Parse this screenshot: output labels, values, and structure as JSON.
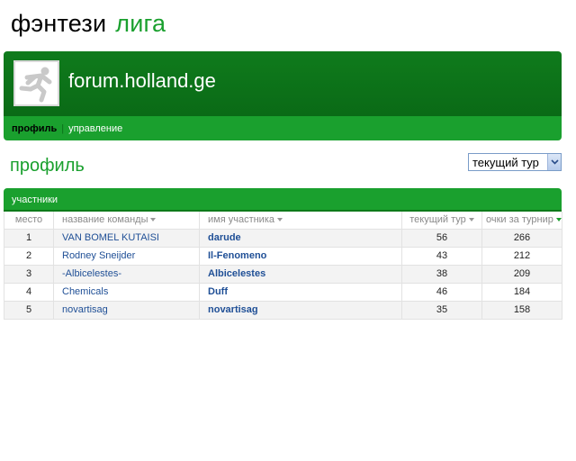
{
  "site": {
    "title_word1": "фэнтези",
    "title_word2": "лига"
  },
  "league": {
    "logo_icon": "runner-icon",
    "name": "forum.holland.ge",
    "tabs": [
      {
        "label": "профиль",
        "active": true
      },
      {
        "label": "управление",
        "active": false
      }
    ]
  },
  "section": {
    "title": "профиль"
  },
  "period_select": {
    "value": "текущий тур"
  },
  "members": {
    "title": "участники",
    "columns": [
      "место",
      "название команды",
      "имя участника",
      "текущий тур",
      "очки за турнир"
    ],
    "rows": [
      {
        "rank": "1",
        "team": "VAN BOMEL KUTAISI",
        "manager": "darude",
        "current": "56",
        "total": "266"
      },
      {
        "rank": "2",
        "team": "Rodney Sneijder",
        "manager": "Il-Fenomeno",
        "current": "43",
        "total": "212"
      },
      {
        "rank": "3",
        "team": "-Albicelestes-",
        "manager": "Albicelestes",
        "current": "38",
        "total": "209"
      },
      {
        "rank": "4",
        "team": "Chemicals",
        "manager": "Duff",
        "current": "46",
        "total": "184"
      },
      {
        "rank": "5",
        "team": "novartisag",
        "manager": "novartisag",
        "current": "35",
        "total": "158"
      }
    ]
  },
  "colors": {
    "brand_green": "#1aa02e",
    "dark_green": "#0f7b1c",
    "link_blue": "#1f4f96"
  }
}
